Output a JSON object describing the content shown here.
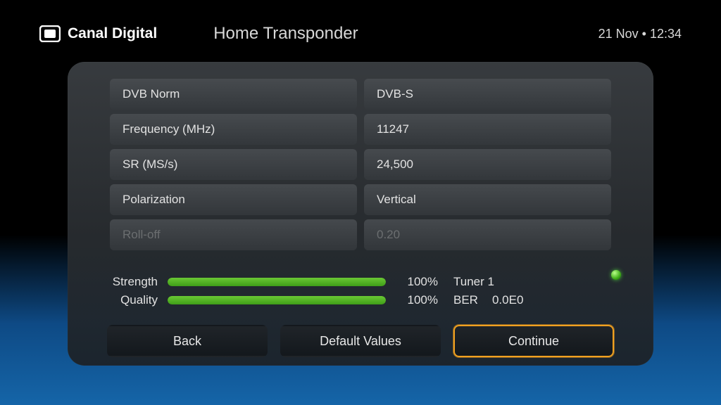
{
  "brand": "Canal Digital",
  "page_title": "Home Transponder",
  "datetime": "21 Nov • 12:34",
  "settings": [
    {
      "label": "DVB Norm",
      "value": "DVB-S",
      "dim": false
    },
    {
      "label": "Frequency (MHz)",
      "value": "11247",
      "dim": false
    },
    {
      "label": "SR (MS/s)",
      "value": "24,500",
      "dim": false
    },
    {
      "label": "Polarization",
      "value": "Vertical",
      "dim": false
    },
    {
      "label": "Roll-off",
      "value": "0.20",
      "dim": true
    }
  ],
  "signal": {
    "strength_label": "Strength",
    "strength_pct": "100%",
    "strength_fill": 100,
    "quality_label": "Quality",
    "quality_pct": "100%",
    "quality_fill": 100,
    "tuner_label": "Tuner 1",
    "ber_label": "BER",
    "ber_value": "0.0E0"
  },
  "buttons": {
    "back": "Back",
    "defaults": "Default Values",
    "continue": "Continue"
  }
}
